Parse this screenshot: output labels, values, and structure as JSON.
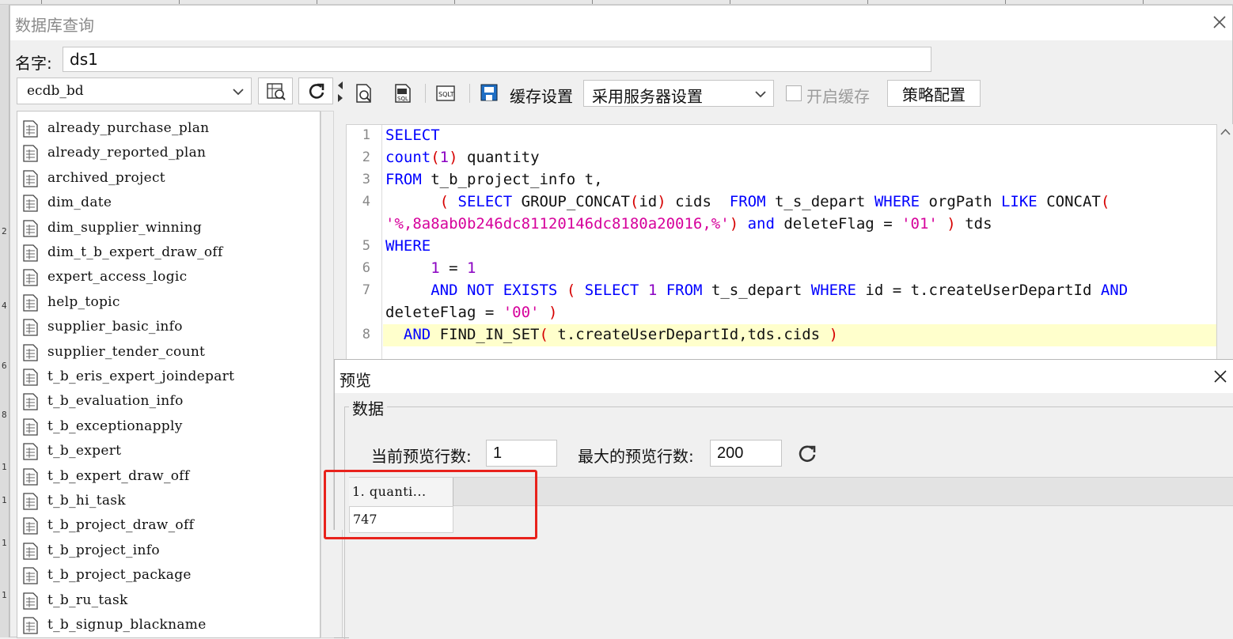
{
  "window": {
    "title": "数据库查询"
  },
  "name_field": {
    "label": "名字:",
    "value": "ds1"
  },
  "left_panel": {
    "database": "ecdb_bd",
    "tables": [
      "already_purchase_plan",
      "already_reported_plan",
      "archived_project",
      "dim_date",
      "dim_supplier_winning",
      "dim_t_b_expert_draw_off",
      "expert_access_logic",
      "help_topic",
      "supplier_basic_info",
      "supplier_tender_count",
      "t_b_eris_expert_joindepart",
      "t_b_evaluation_info",
      "t_b_exceptionapply",
      "t_b_expert",
      "t_b_expert_draw_off",
      "t_b_hi_task",
      "t_b_project_draw_off",
      "t_b_project_info",
      "t_b_project_package",
      "t_b_ru_task",
      "t_b_signup_blackname"
    ]
  },
  "toolbar": {
    "cache_label": "缓存设置",
    "cache_option": "采用服务器设置",
    "enable_cache_label": "开启缓存",
    "policy_button": "策略配置"
  },
  "editor": {
    "line_numbers": [
      "1",
      "2",
      "3",
      "4",
      "5",
      "6",
      "7",
      "8"
    ]
  },
  "preview": {
    "title": "预览",
    "group_title": "数据",
    "current_rows_label": "当前预览行数:",
    "current_rows_value": "1",
    "max_rows_label": "最大的预览行数:",
    "max_rows_value": "200",
    "column_header": "1. quanti...",
    "cell_value": "747"
  },
  "left_strip_digits": [
    "2",
    "4",
    "6",
    "8",
    "1",
    "1",
    "1",
    "1"
  ]
}
